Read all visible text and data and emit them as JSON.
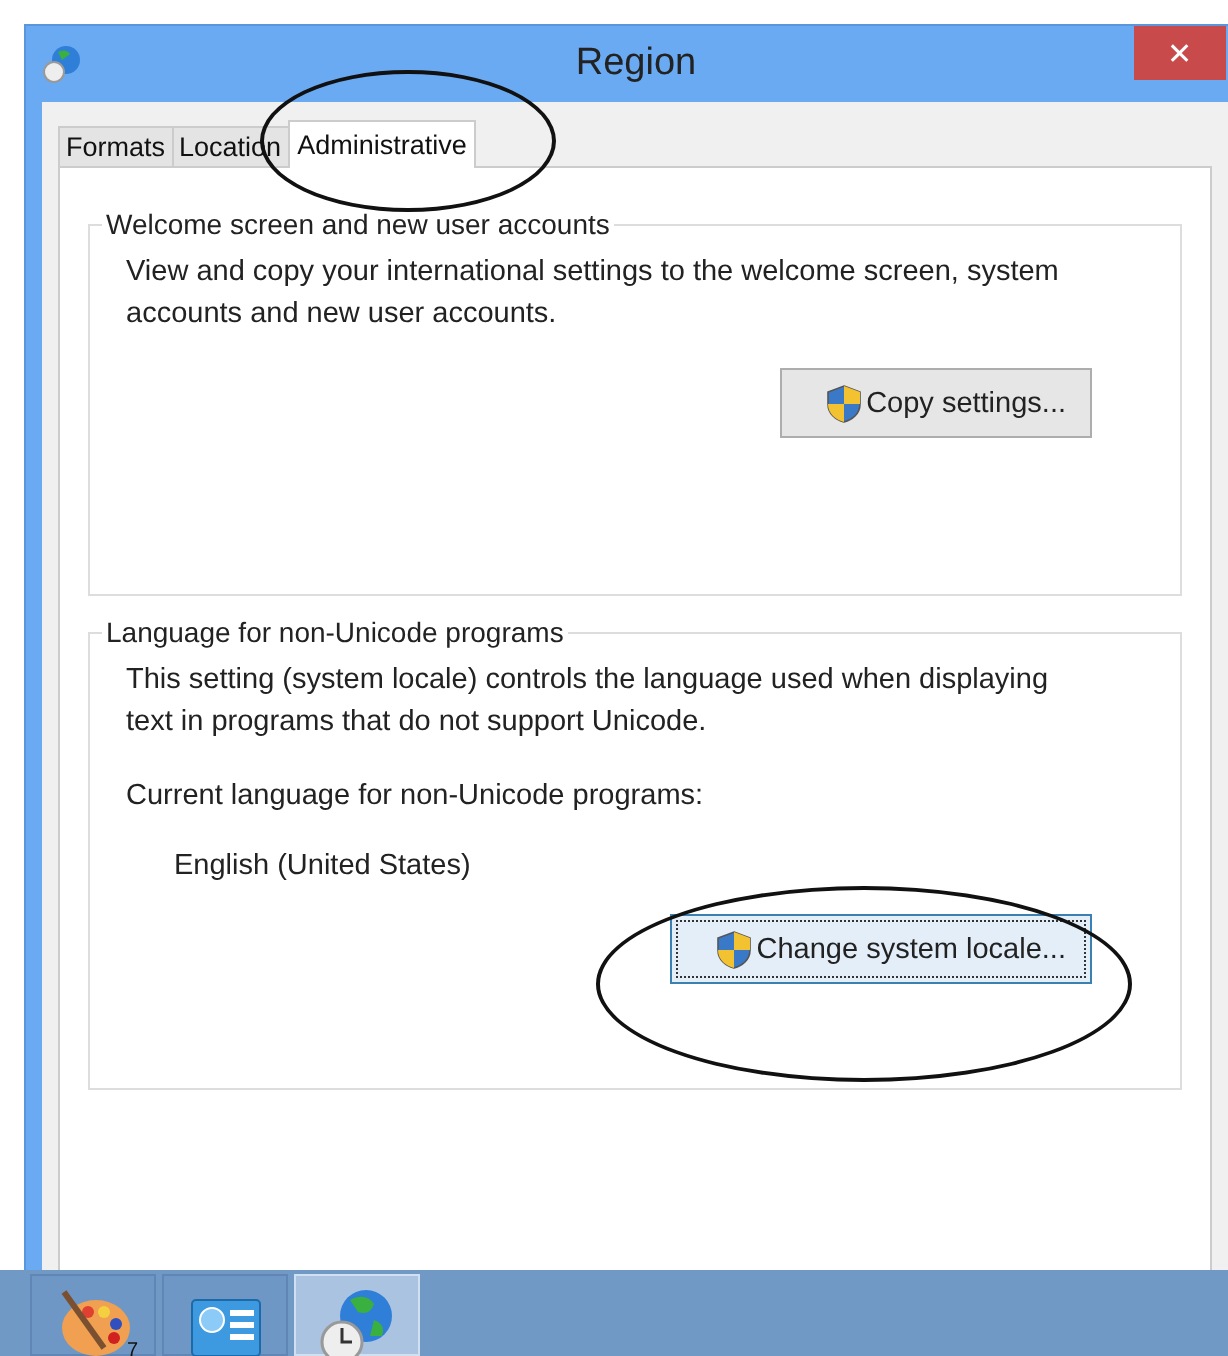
{
  "window": {
    "title": "Region",
    "close": "✕"
  },
  "tabs": [
    {
      "label": "Formats",
      "selected": false
    },
    {
      "label": "Location",
      "selected": false
    },
    {
      "label": "Administrative",
      "selected": true
    }
  ],
  "groups": [
    {
      "title": "Welcome screen and new user accounts",
      "paragraphs": [
        "View and copy your international settings to the welcome screen, system accounts and new user accounts."
      ],
      "button": {
        "label": "Copy settings...",
        "focused": false
      }
    },
    {
      "title": "Language for non-Unicode programs",
      "paragraphs": [
        "This setting (system locale) controls the language used when displaying text in programs that do not support Unicode.",
        "Current language for non-Unicode programs:"
      ],
      "value": "English (United States)",
      "button": {
        "label": "Change system locale...",
        "focused": true
      }
    }
  ],
  "annotations": [
    {
      "kind": "ellipse"
    },
    {
      "kind": "ellipse"
    }
  ],
  "taskbar": {
    "items": [
      {
        "kind": "palette",
        "selected": false,
        "badge": "7"
      },
      {
        "kind": "panel",
        "selected": false
      },
      {
        "kind": "globe",
        "selected": true
      }
    ]
  }
}
